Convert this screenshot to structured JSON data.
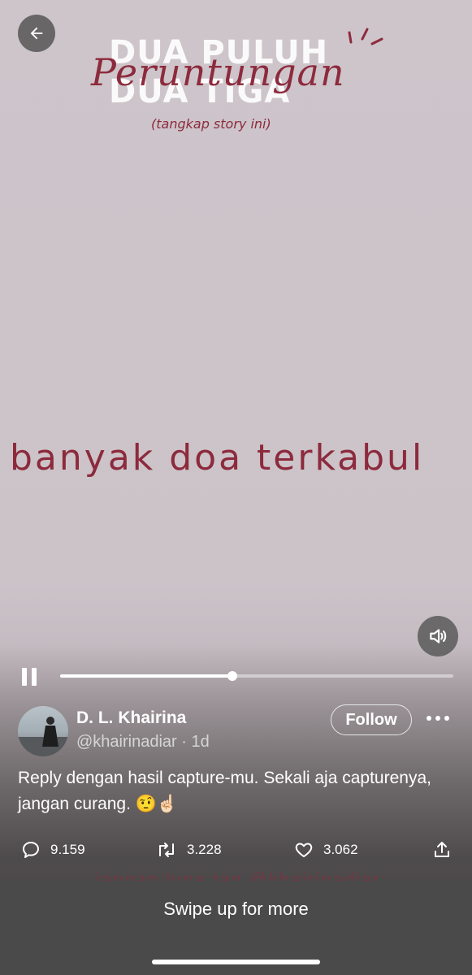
{
  "media": {
    "bg_title_line1": "DUA PULUH",
    "bg_title_line2": "DUA       TIGA",
    "script_title": "Peruntungan",
    "subtitle": "(tangkap story ini)",
    "fortune": "banyak doa terkabul",
    "ghost_text": "jangan lupa tag @khairinadiar"
  },
  "player": {
    "progress_fraction": 0.437
  },
  "tweet": {
    "display_name": "D. L. Khairina",
    "handle": "@khairinadiar",
    "separator": " · ",
    "time": "1d",
    "follow_label": "Follow",
    "text": "Reply dengan hasil capture-mu. Sekali aja capturenya, jangan curang. 🤨☝🏻",
    "reply_count": "9.159",
    "retweet_count": "3.228",
    "like_count": "3.062"
  },
  "footer": {
    "swipe_label": "Swipe up for more"
  },
  "colors": {
    "accent_text": "#8d2a3d",
    "backdrop": "#cbc3c8"
  }
}
